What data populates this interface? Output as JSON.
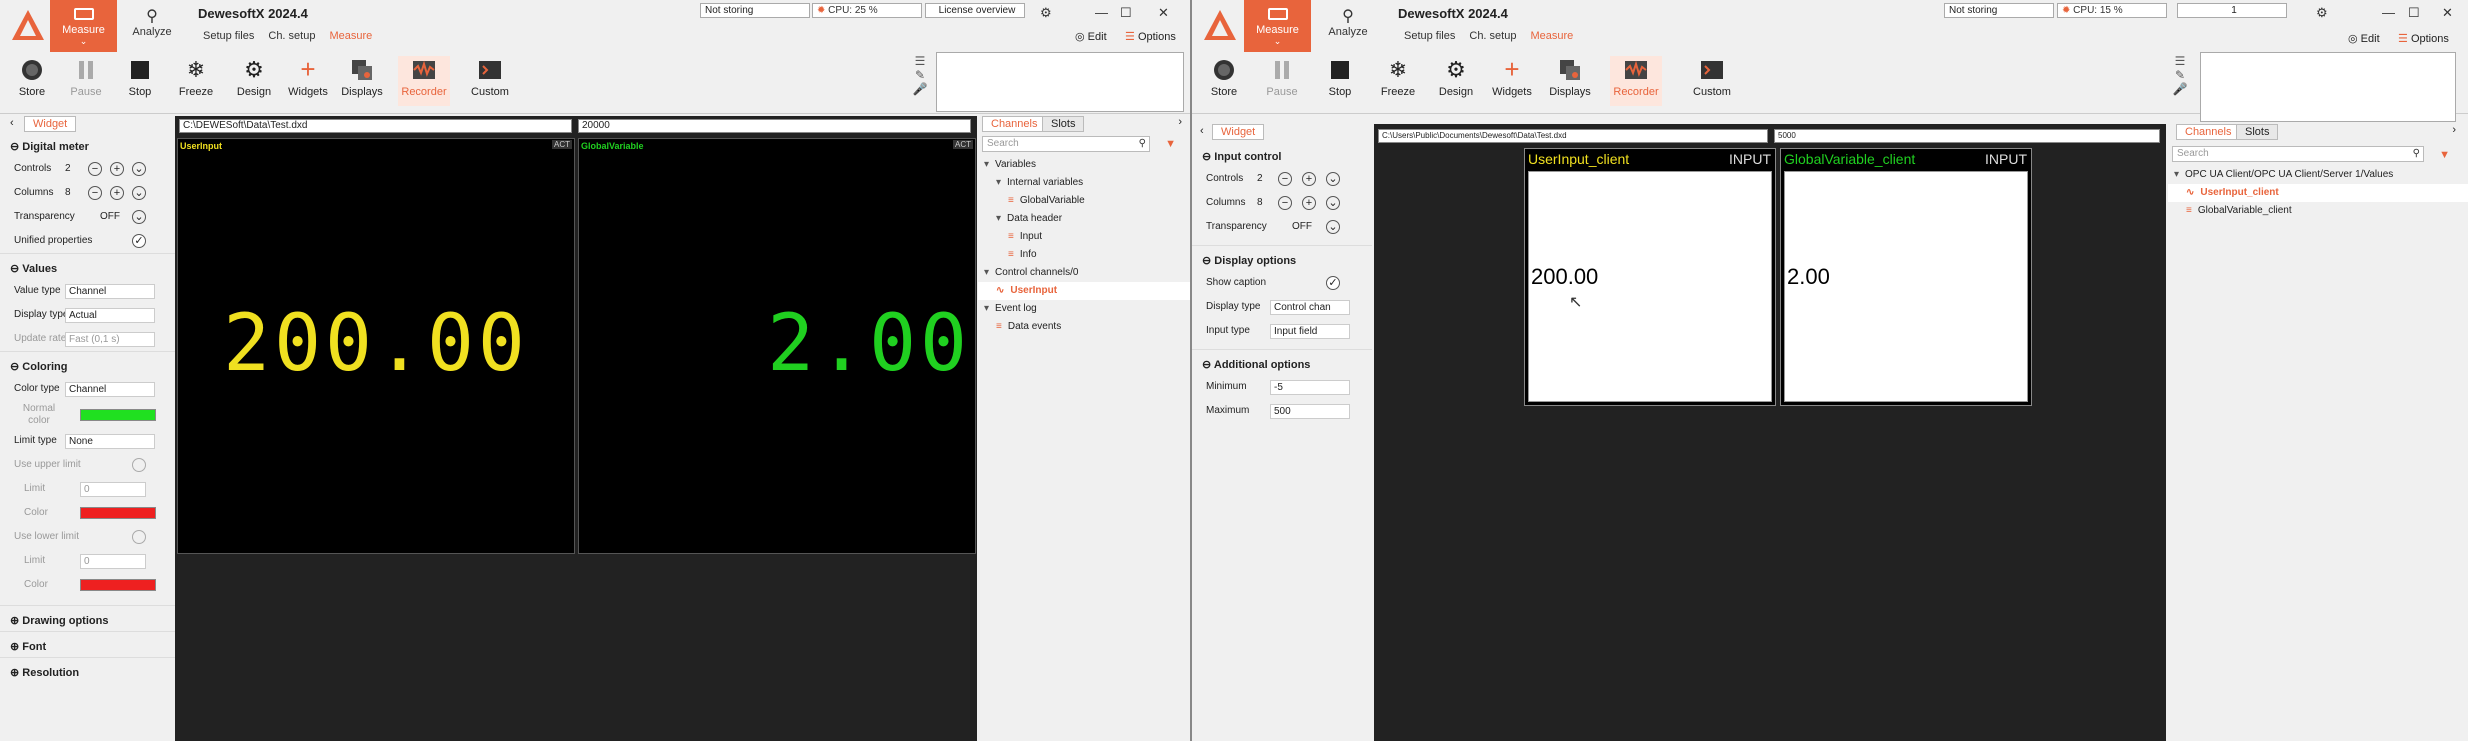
{
  "left": {
    "app_title": "DewesoftX 2024.4",
    "measure_label": "Measure",
    "analyze_label": "Analyze",
    "nav": [
      "Setup files",
      "Ch. setup",
      "Measure"
    ],
    "storing": "Not storing",
    "cpu": "CPU: 25 %",
    "license": "License overview",
    "edit": "Edit",
    "options": "Options",
    "ribbon": [
      "Store",
      "Pause",
      "Stop",
      "Freeze",
      "Design",
      "Widgets",
      "Displays",
      "Recorder",
      "Custom"
    ],
    "widget_tab": "Widget",
    "path": "C:\\DEWESoft\\Data\\Test.dxd",
    "value_box": "20000",
    "sections": {
      "digital_meter": "Digital meter",
      "values": "Values",
      "coloring": "Coloring",
      "drawing": "Drawing options",
      "font": "Font",
      "resolution": "Resolution"
    },
    "props": {
      "controls": "Controls",
      "controls_val": "2",
      "columns": "Columns",
      "columns_val": "8",
      "transparency": "Transparency",
      "transparency_val": "OFF",
      "unified": "Unified properties",
      "value_type": "Value type",
      "value_type_val": "Channel",
      "display_type": "Display type",
      "display_type_val": "Actual",
      "update_rate": "Update rate",
      "update_rate_val": "Fast (0,1 s)",
      "color_type": "Color type",
      "color_type_val": "Channel",
      "normal_color": "Normal color",
      "limit_type": "Limit type",
      "limit_type_val": "None",
      "use_upper": "Use upper limit",
      "limit": "Limit",
      "limit_val": "0",
      "color": "Color",
      "use_lower": "Use lower limit",
      "limit2_val": "0"
    },
    "meters": [
      {
        "caption": "UserInput",
        "badge": "ACT",
        "value": "200.00",
        "color": "#f0e020"
      },
      {
        "caption": "GlobalVariable",
        "badge": "ACT",
        "value": "2.00",
        "color": "#20d020"
      }
    ],
    "channels_tab": "Channels",
    "slots_tab": "Slots",
    "search": "Search",
    "tree": [
      {
        "label": "Variables",
        "lvl": 0,
        "sel": false
      },
      {
        "label": "Internal variables",
        "lvl": 1,
        "sel": false
      },
      {
        "label": "GlobalVariable",
        "lvl": 2,
        "sel": false
      },
      {
        "label": "Data header",
        "lvl": 1,
        "sel": false
      },
      {
        "label": "Input",
        "lvl": 2,
        "sel": false
      },
      {
        "label": "Info",
        "lvl": 2,
        "sel": false
      },
      {
        "label": "Control channels/0",
        "lvl": 0,
        "sel": false
      },
      {
        "label": "UserInput",
        "lvl": 1,
        "sel": true
      },
      {
        "label": "Event log",
        "lvl": 0,
        "sel": false
      },
      {
        "label": "Data events",
        "lvl": 1,
        "sel": false
      }
    ]
  },
  "right": {
    "app_title": "DewesoftX 2024.4",
    "measure_label": "Measure",
    "analyze_label": "Analyze",
    "nav": [
      "Setup files",
      "Ch. setup",
      "Measure"
    ],
    "storing": "Not storing",
    "cpu": "CPU: 15 %",
    "counter": "1",
    "edit": "Edit",
    "options": "Options",
    "ribbon": [
      "Store",
      "Pause",
      "Stop",
      "Freeze",
      "Design",
      "Widgets",
      "Displays",
      "Recorder",
      "Custom"
    ],
    "widget_tab": "Widget",
    "path": "C:\\Users\\Public\\Documents\\Dewesoft\\Data\\Test.dxd",
    "value_box": "5000",
    "sections": {
      "input_control": "Input control",
      "display_options": "Display options",
      "additional": "Additional options"
    },
    "props": {
      "controls": "Controls",
      "controls_val": "2",
      "columns": "Columns",
      "columns_val": "8",
      "transparency": "Transparency",
      "transparency_val": "OFF",
      "show_caption": "Show caption",
      "display_type": "Display type",
      "display_type_val": "Control chan",
      "input_type": "Input type",
      "input_type_val": "Input field",
      "minimum": "Minimum",
      "minimum_val": "-5",
      "maximum": "Maximum",
      "maximum_val": "500"
    },
    "inputs": [
      {
        "caption": "UserInput_client",
        "badge": "INPUT",
        "value": "200.00",
        "color": "#f0e020"
      },
      {
        "caption": "GlobalVariable_client",
        "badge": "INPUT",
        "value": "2.00",
        "color": "#20d020"
      }
    ],
    "channels_tab": "Channels",
    "slots_tab": "Slots",
    "search": "Search",
    "tree": [
      {
        "label": "OPC UA Client/OPC UA Client/Server 1/Values",
        "lvl": 0,
        "sel": false
      },
      {
        "label": "UserInput_client",
        "lvl": 1,
        "sel": true
      },
      {
        "label": "GlobalVariable_client",
        "lvl": 1,
        "sel": false
      }
    ]
  }
}
